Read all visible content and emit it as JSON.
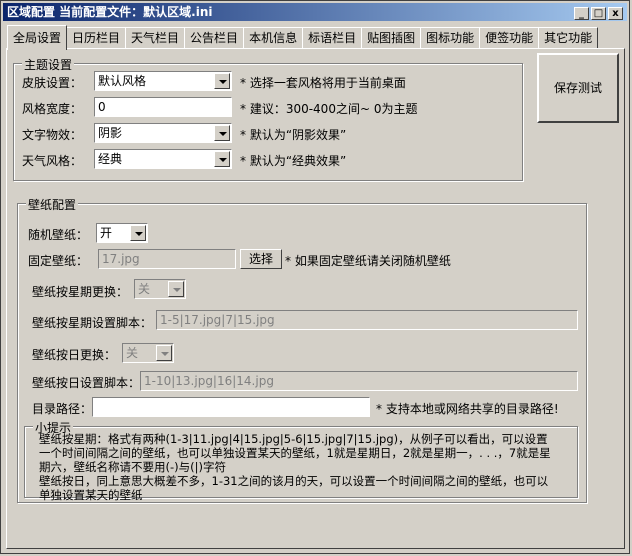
{
  "window": {
    "title": "区域配置 当前配置文件：默认区域.ini",
    "min_label": "_",
    "max_label": "□",
    "close_label": "x"
  },
  "tabs": [
    "全局设置",
    "日历栏目",
    "天气栏目",
    "公告栏目",
    "本机信息",
    "标语栏目",
    "贴图插图",
    "图标功能",
    "便签功能",
    "其它功能"
  ],
  "theme": {
    "title": "主题设置",
    "skin": {
      "label": "皮肤设置：",
      "value": "默认风格",
      "note": "* 选择一套风格将用于当前桌面"
    },
    "width": {
      "label": "风格宽度：",
      "value": "0",
      "note": "* 建议：300-400之间~ 0为主题"
    },
    "text_effect": {
      "label": "文字物效：",
      "value": "阴影",
      "note": "* 默认为“阴影效果”"
    },
    "weather_style": {
      "label": "天气风格：",
      "value": "经典",
      "note": "* 默认为“经典效果”"
    }
  },
  "save_button": "保存测试",
  "wallpaper": {
    "title": "壁纸配置",
    "random": {
      "label": "随机壁纸：",
      "value": "开"
    },
    "fixed": {
      "label": "固定壁纸：",
      "value": "17.jpg",
      "button": "选择",
      "note": "* 如果固定壁纸请关闭随机壁纸"
    },
    "weekly": {
      "label": "壁纸按星期更换：",
      "value": "关"
    },
    "weekly_script": {
      "label": "壁纸按星期设置脚本：",
      "value": "1-5|17.jpg|7|15.jpg"
    },
    "daily": {
      "label": "壁纸按日更换：",
      "value": "关"
    },
    "daily_script": {
      "label": "壁纸按日设置脚本：",
      "value": "1-10|13.jpg|16|14.jpg"
    },
    "dir": {
      "label": "目录路径：",
      "value": "",
      "note": "* 支持本地或网络共享的目录路径!"
    }
  },
  "tips": {
    "title": "小提示",
    "line1": "壁纸按星期：格式有两种(1-3|11.jpg|4|15.jpg|5-6|15.jpg|7|15.jpg)，从例子可以看出，可以设置一个时间间隔之间的壁纸，也可以单独设置某天的壁纸，1就是星期日，2就是星期一，. . .，7就是星期六，壁纸名称请不要用(-)与(|)字符",
    "line2": "壁纸按日，同上意思大概差不多，1-31之间的该月的天，可以设置一个时间间隔之间的壁纸，也可以单独设置某天的壁纸"
  }
}
